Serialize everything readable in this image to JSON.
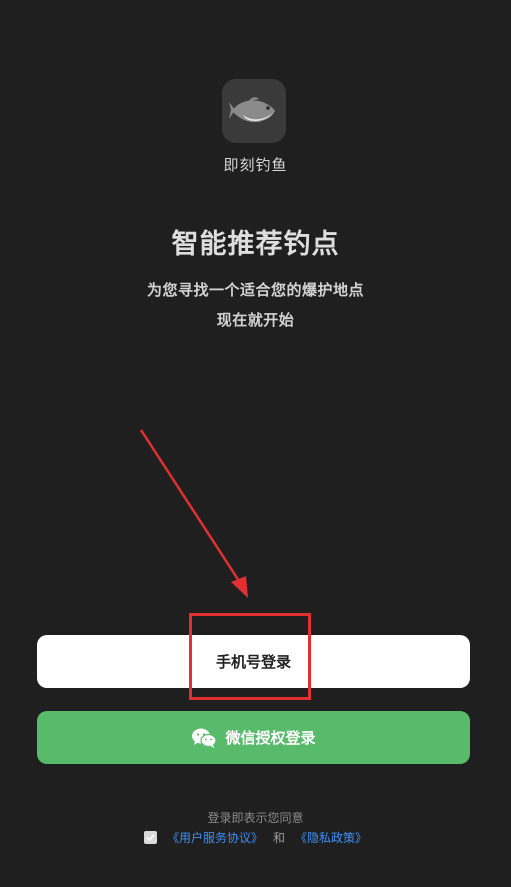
{
  "app": {
    "name": "即刻钓鱼",
    "icon": "fish-icon"
  },
  "hero": {
    "title": "智能推荐钓点",
    "subtitle_line1": "为您寻找一个适合您的爆护地点",
    "subtitle_line2": "现在就开始"
  },
  "buttons": {
    "phone_login": "手机号登录",
    "wechat_login": "微信授权登录",
    "wechat_icon": "wechat-icon"
  },
  "agreement": {
    "notice": "登录即表示您同意",
    "user_service": "《用户服务协议》",
    "and": "和",
    "privacy": "《隐私政策》",
    "checked": true
  },
  "colors": {
    "background": "#1f1f1f",
    "wechat_green": "#57bb6b",
    "link_blue": "#3f8ff5",
    "annotation_red": "#e23030"
  }
}
